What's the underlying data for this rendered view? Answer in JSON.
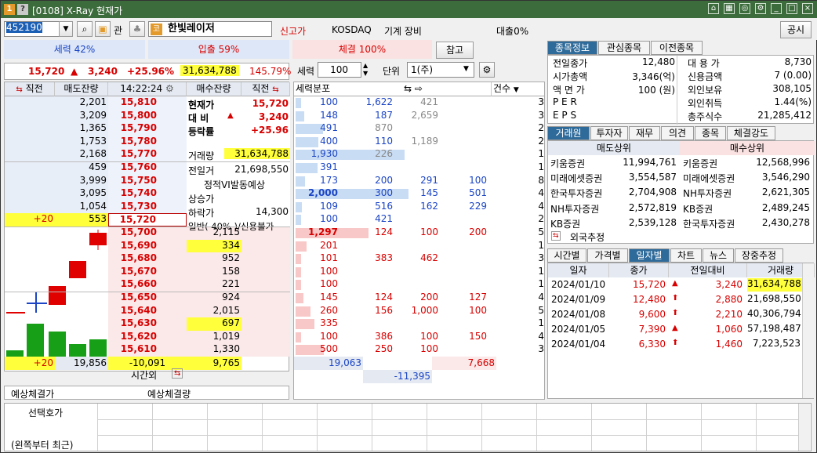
{
  "window": {
    "num_badge": "1",
    "help_badge": "?",
    "title": "[0108] X-Ray 현재가"
  },
  "toolbar": {
    "code": "452190",
    "gwan": "관",
    "stock_badge": "코",
    "stock_name": "한빛레이저",
    "alert": "신고가",
    "market": "KOSDAQ",
    "sector": "기계 장비",
    "loan": "대출0%",
    "notice": "공시"
  },
  "ratios": {
    "ask": "세력 42%",
    "bid": "입출 59%",
    "exec": "체결 100%",
    "ref": "참고"
  },
  "price_line": {
    "price": "15,720",
    "arrow": "▲",
    "change": "3,240",
    "rate": "+25.96%",
    "volume": "31,634,788",
    "vol_rate": "145.79%"
  },
  "orderbook": {
    "headers": {
      "prev_l": "직전",
      "ask_qty": "매도잔량",
      "time": "14:22:24",
      "bid_qty": "매수잔량",
      "prev_r": "직전"
    },
    "asks": [
      {
        "qty": "2,201",
        "price": "15,810"
      },
      {
        "qty": "3,209",
        "price": "15,800"
      },
      {
        "qty": "1,365",
        "price": "15,790"
      },
      {
        "qty": "1,753",
        "price": "15,780"
      },
      {
        "qty": "2,168",
        "price": "15,770"
      },
      {
        "qty": "459",
        "price": "15,760"
      },
      {
        "qty": "3,999",
        "price": "15,750"
      },
      {
        "qty": "3,095",
        "price": "15,740"
      },
      {
        "qty": "1,054",
        "price": "15,730"
      },
      {
        "qty": "553",
        "price": "15,720",
        "prev": "+20"
      }
    ],
    "bids": [
      {
        "price": "15,700",
        "qty": "2,115"
      },
      {
        "price": "15,690",
        "qty": "334"
      },
      {
        "price": "15,680",
        "qty": "952"
      },
      {
        "price": "15,670",
        "qty": "158"
      },
      {
        "price": "15,660",
        "qty": "221"
      },
      {
        "price": "15,650",
        "qty": "924"
      },
      {
        "price": "15,640",
        "qty": "2,015"
      },
      {
        "price": "15,630",
        "qty": "697"
      },
      {
        "price": "15,620",
        "qty": "1,019"
      },
      {
        "price": "15,610",
        "qty": "1,330"
      }
    ],
    "info": {
      "cur_label": "현재가",
      "cur_val": "15,720",
      "diff_label": "대 비",
      "diff_arrow": "▲",
      "diff_val": "3,240",
      "rate_label": "등락률",
      "rate_val": "+25.96",
      "vol_label": "거래량",
      "vol_val": "31,634,788",
      "prev_vol_label": "전일거",
      "prev_vol_val": "21,698,550",
      "vi": "정적VI발동예상",
      "upper_label": "상승가",
      "lower_label": "하락가",
      "lower_val": "14,300",
      "margin": "일반( 40% )/신용불가"
    },
    "footer": {
      "prev": "+20",
      "ask_total": "19,856",
      "diff": "-10,091",
      "bid_total": "9,765",
      "after": "시간외"
    },
    "expected": {
      "exp_price": "예상체결가",
      "exp_vol": "예상체결량"
    }
  },
  "analysis": {
    "label_force": "세력",
    "force_val": "100",
    "label_unit": "단위",
    "unit_val": "1(주)",
    "col1": "세력분포",
    "col2": "건수",
    "rows": [
      [
        "100",
        "1,622",
        "421",
        "",
        "3"
      ],
      [
        "148",
        "187",
        "2,659",
        "",
        "3"
      ],
      [
        "491",
        "870",
        "",
        "",
        "2"
      ],
      [
        "400",
        "110",
        "1,189",
        "",
        "2"
      ],
      [
        "1,930",
        "226",
        "",
        "",
        "1"
      ],
      [
        "391",
        "",
        "",
        "",
        "1"
      ],
      [
        "173",
        "200",
        "291",
        "100",
        "8"
      ],
      [
        "2,000",
        "300",
        "145",
        "501",
        "4"
      ],
      [
        "109",
        "516",
        "162",
        "229",
        "4"
      ],
      [
        "100",
        "421",
        "",
        "",
        "2"
      ],
      [
        "1,297",
        "124",
        "100",
        "200",
        "5"
      ],
      [
        "201",
        "",
        "",
        "",
        "1"
      ],
      [
        "101",
        "383",
        "462",
        "",
        "3"
      ],
      [
        "100",
        "",
        "",
        "",
        "1"
      ],
      [
        "100",
        "",
        "",
        "",
        "1"
      ],
      [
        "145",
        "124",
        "200",
        "127",
        "4"
      ],
      [
        "260",
        "156",
        "1,000",
        "100",
        "5"
      ],
      [
        "335",
        "",
        "",
        "",
        "1"
      ],
      [
        "100",
        "386",
        "100",
        "150",
        "4"
      ],
      [
        "500",
        "250",
        "100",
        "",
        "3"
      ]
    ],
    "total_ask": "19,063",
    "total_bid": "7,668",
    "total_diff": "-11,395"
  },
  "right": {
    "tabs1": [
      "종목정보",
      "관심종목",
      "이전종목"
    ],
    "info": [
      [
        "전일종가",
        "12,480",
        "대 용 가",
        "8,730"
      ],
      [
        "시가총액",
        "3,346(억)",
        "신용금액",
        "7  (0.00)"
      ],
      [
        "액 면 가",
        "100 (원)",
        "외인보유",
        "308,105"
      ],
      [
        "P E R",
        "",
        "외인취득",
        "1.44(%)"
      ],
      [
        "E P S",
        "",
        "총주식수",
        "21,285,412"
      ]
    ],
    "tabs2": [
      "거래원",
      "투자자",
      "재무",
      "의견",
      "종목",
      "체결강도"
    ],
    "broker_head": [
      "매도상위",
      "매수상위"
    ],
    "brokers": [
      [
        "키움증권",
        "11,994,761",
        "키움증권",
        "12,568,996"
      ],
      [
        "미래에셋증권",
        "3,554,587",
        "미래에셋증권",
        "3,546,290"
      ],
      [
        "한국투자증권",
        "2,704,908",
        "NH투자증권",
        "2,621,305"
      ],
      [
        "NH투자증권",
        "2,572,819",
        "KB증권",
        "2,489,245"
      ],
      [
        "KB증권",
        "2,539,128",
        "한국투자증권",
        "2,430,278"
      ]
    ],
    "foreign": "외국추정",
    "tabs3": [
      "시간별",
      "가격별",
      "일자별",
      "차트",
      "뉴스",
      "장중추정"
    ],
    "daily_head": [
      "일자",
      "종가",
      "전일대비",
      "거래량"
    ],
    "daily": [
      [
        "2024/01/10",
        "15,720",
        "▲",
        "3,240",
        "31,634,788"
      ],
      [
        "2024/01/09",
        "12,480",
        "⬆",
        "2,880",
        "21,698,550"
      ],
      [
        "2024/01/08",
        "9,600",
        "⬆",
        "2,210",
        "40,306,794"
      ],
      [
        "2024/01/05",
        "7,390",
        "▲",
        "1,060",
        "57,198,487"
      ],
      [
        "2024/01/04",
        "6,330",
        "⬆",
        "1,460",
        "7,223,523"
      ]
    ]
  },
  "bottom": {
    "sel_label": "선택호가",
    "recent_label": "(왼쪽부터 최근)"
  },
  "colors": {
    "title_green": "#3c6b3c",
    "up_red": "#d80000",
    "down_blue": "#1b45c5",
    "highlight": "#ffff3c"
  }
}
